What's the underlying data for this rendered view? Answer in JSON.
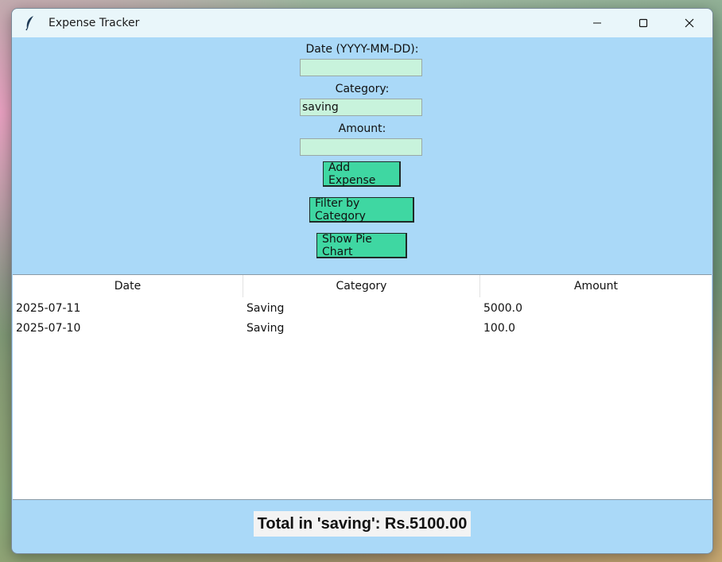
{
  "window": {
    "title": "Expense Tracker",
    "icon": "feather-icon",
    "controls": [
      "minimize-icon",
      "maximize-icon",
      "close-icon"
    ]
  },
  "form": {
    "date_label": "Date (YYYY-MM-DD):",
    "date_value": "",
    "category_label": "Category:",
    "category_value": "saving",
    "amount_label": "Amount:",
    "amount_value": "",
    "add_button": "Add Expense",
    "filter_button": "Filter by Category",
    "pie_button": "Show Pie Chart"
  },
  "table": {
    "columns": [
      "Date",
      "Category",
      "Amount"
    ],
    "rows": [
      [
        "2025-07-11",
        "Saving",
        "5000.0"
      ],
      [
        "2025-07-10",
        "Saving",
        "100.0"
      ]
    ]
  },
  "footer": {
    "total_text": "Total in 'saving': Rs.5100.00"
  },
  "colors": {
    "background": "#aad9f8",
    "field": "#c8f3dc",
    "button": "#3fd7a2",
    "titlebar": "#e9f6fa"
  }
}
